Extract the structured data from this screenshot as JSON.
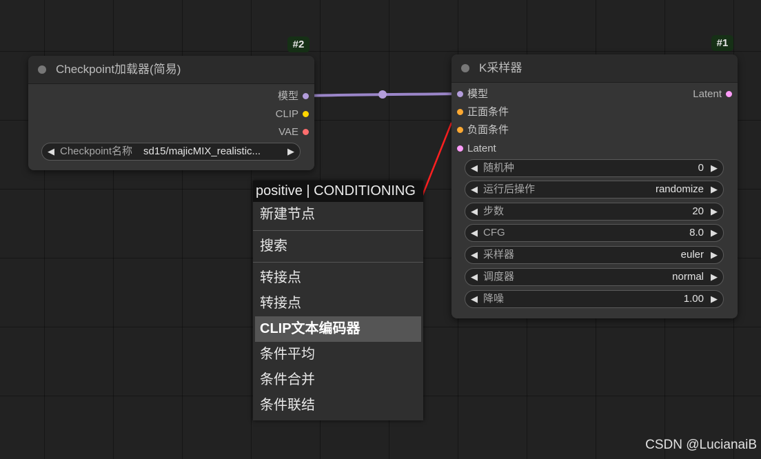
{
  "colors": {
    "model": "#b39ddb",
    "clip": "#ffd500",
    "vae": "#ff6e6e",
    "conditioning": "#ffa931",
    "latent": "#ff9cf9",
    "arrow": "#ff2020"
  },
  "node2": {
    "badge": "#2",
    "title": "Checkpoint加载器(简易)",
    "outputs": {
      "model": "模型",
      "clip": "CLIP",
      "vae": "VAE"
    },
    "widget": {
      "label": "Checkpoint名称",
      "value": "sd15/majicMIX_realistic..."
    }
  },
  "node1": {
    "badge": "#1",
    "title": "K采样器",
    "inputs": {
      "model": "模型",
      "positive": "正面条件",
      "negative": "负面条件",
      "latent": "Latent"
    },
    "output": "Latent",
    "widgets": [
      {
        "label": "随机种",
        "value": "0"
      },
      {
        "label": "运行后操作",
        "value": "randomize"
      },
      {
        "label": "步数",
        "value": "20"
      },
      {
        "label": "CFG",
        "value": "8.0"
      },
      {
        "label": "采样器",
        "value": "euler"
      },
      {
        "label": "调度器",
        "value": "normal"
      },
      {
        "label": "降噪",
        "value": "1.00"
      }
    ]
  },
  "context_menu": {
    "title": "positive | CONDITIONING",
    "items": [
      "新建节点",
      "搜索",
      "转接点",
      "转接点",
      "CLIP文本编码器",
      "条件平均",
      "条件合并",
      "条件联结"
    ],
    "highlighted": "CLIP文本编码器"
  },
  "watermark": "CSDN @LucianaiB"
}
